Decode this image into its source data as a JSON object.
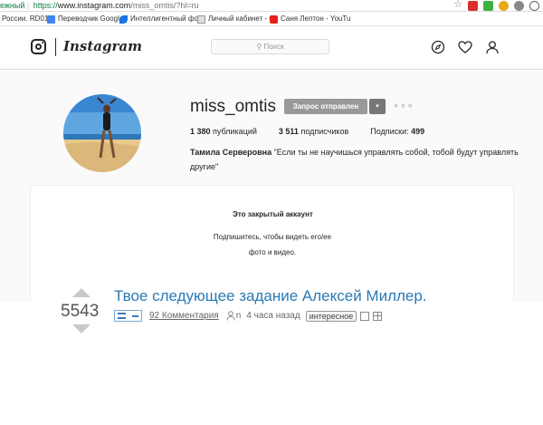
{
  "browser": {
    "security_label": "ежный",
    "url_protocol": "https://",
    "url_host": "www.instagram.com",
    "url_path": "/miss_omtis/?hl=ru",
    "bookmarks": [
      {
        "label": "России. RD01…",
        "icon": "globe-icon"
      },
      {
        "label": "Переводчик Google",
        "icon": "google-translate-icon"
      },
      {
        "label": "Интеллигентный фо",
        "icon": "bookmark-icon"
      },
      {
        "label": "Личный кабинет - С",
        "icon": "page-icon"
      },
      {
        "label": "Саня Лептон - YouTu",
        "icon": "youtube-icon"
      }
    ]
  },
  "instagram": {
    "wordmark": "Instagram",
    "search_placeholder": "Поиск",
    "search_icon": "⚲",
    "nav_icons": [
      "compass-icon",
      "heart-icon",
      "profile-icon"
    ]
  },
  "profile": {
    "username": "miss_omtis",
    "request_button": "Запрос отправлен",
    "caret": "▾",
    "more": "∘∘∘",
    "posts_count": "1 380",
    "posts_label": "публикаций",
    "followers_count": "3 511",
    "followers_label": "подписчиков",
    "following_label": "Подписки:",
    "following_count": "499",
    "full_name": "Тамила Серверовна",
    "bio_text": "\"Если ты не научишься управлять собой, тобой будут управлять другие\""
  },
  "private": {
    "title": "Это закрытый аккаунт",
    "line1": "Подпишитесь, чтобы видеть его/ее",
    "line2": "фото и видео."
  },
  "post": {
    "score": "5543",
    "title": "Твое следующее задание Алексей Миллер.",
    "comments": "92 Комментария",
    "author_icon_label": "n",
    "time_ago": "4 часа назад",
    "tag": "интересное"
  },
  "colors": {
    "link_blue": "#2979b5",
    "button_gray": "#999999",
    "text_dark": "#262626"
  }
}
